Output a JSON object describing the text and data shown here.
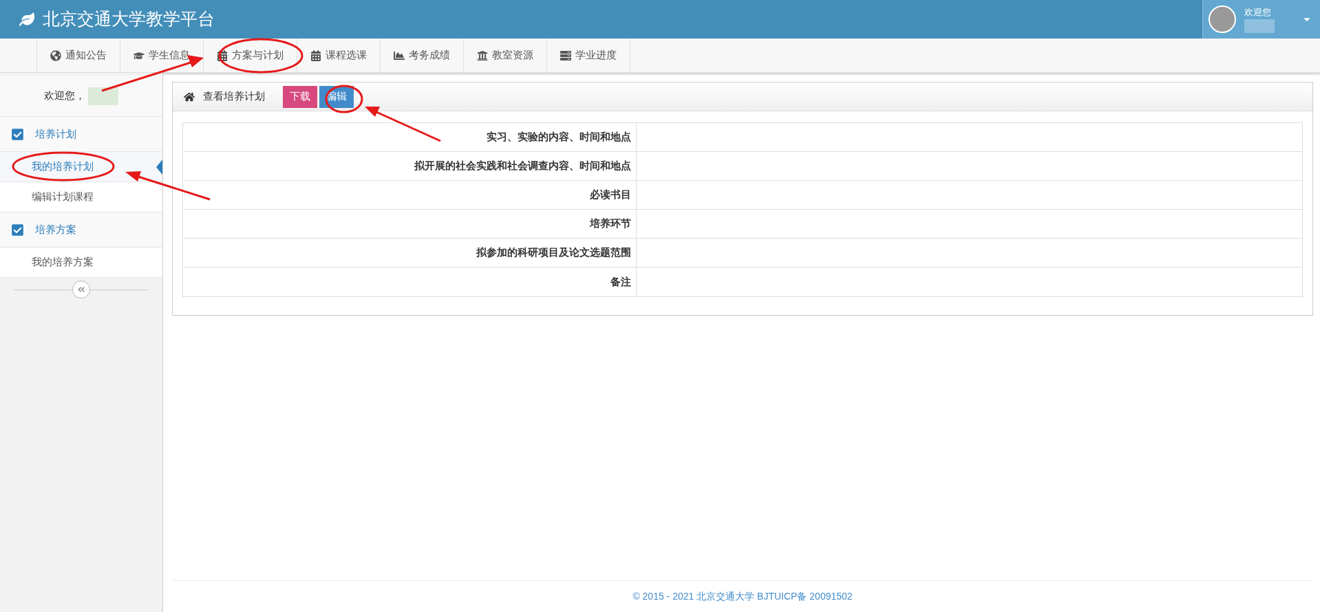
{
  "header": {
    "title": "北京交通大学教学平台",
    "greeting": "欢迎您"
  },
  "nav": [
    "通知公告",
    "学生信息",
    "方案与计划",
    "课程选课",
    "考务成绩",
    "教室资源",
    "学业进度"
  ],
  "sidebar": {
    "welcome": "欢迎您，",
    "groups": [
      {
        "title": "培养计划",
        "checked": true,
        "items": [
          {
            "label": "我的培养计划",
            "selected": true
          },
          {
            "label": "编辑计划课程",
            "selected": false
          }
        ]
      },
      {
        "title": "培养方案",
        "checked": true,
        "items": [
          {
            "label": "我的培养方案",
            "selected": false
          }
        ]
      }
    ]
  },
  "content": {
    "title": "查看培养计划",
    "buttons": [
      {
        "label": "下载",
        "kind": "danger"
      },
      {
        "label": "编辑",
        "kind": "primary"
      }
    ],
    "rows": [
      "实习、实验的内容、时间和地点",
      "拟开展的社会实践和社会调查内容、时间和地点",
      "必读书目",
      "培养环节",
      "拟参加的科研项目及论文选题范围",
      "备注"
    ]
  },
  "footer": "© 2015 - 2021 北京交通大学 BJTUICP备 20091502"
}
